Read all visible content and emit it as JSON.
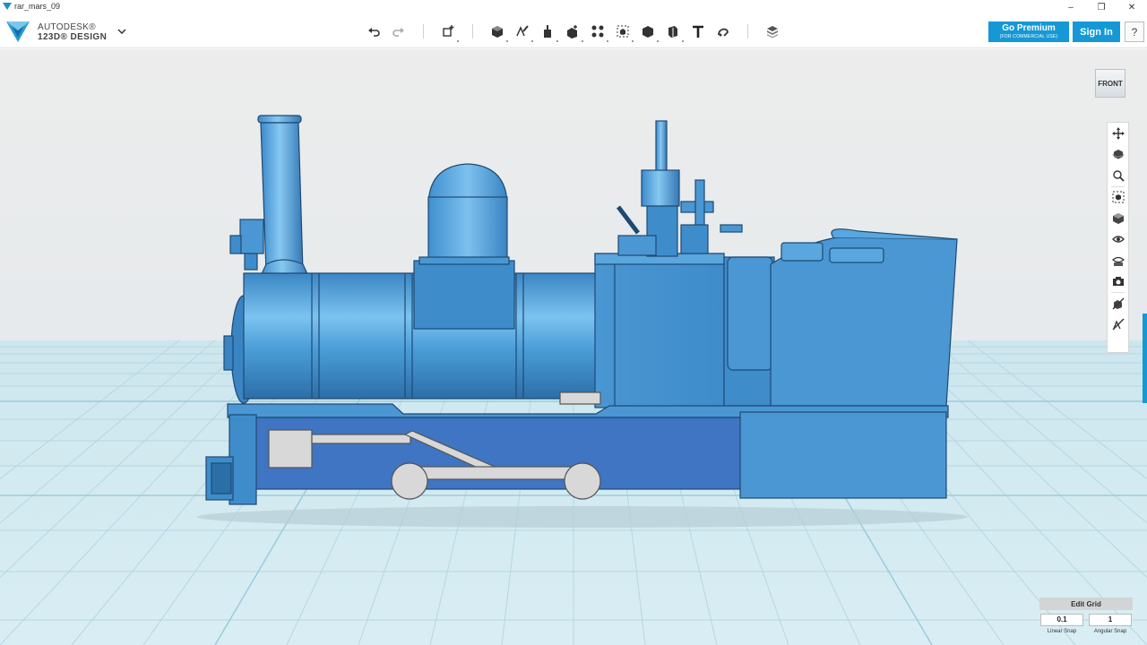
{
  "window": {
    "title": "rar_mars_09",
    "controls": {
      "minimize": "‒",
      "maximize": "❐",
      "close": "✕"
    }
  },
  "brand": {
    "line1": "AUTODESK®",
    "line2": "123D® DESIGN"
  },
  "toolbar": {
    "tools": [
      {
        "name": "undo-icon"
      },
      {
        "name": "redo-icon"
      },
      {
        "name": "transform-icon"
      },
      {
        "name": "primitives-icon"
      },
      {
        "name": "sketch-icon"
      },
      {
        "name": "construct-icon"
      },
      {
        "name": "modify-icon"
      },
      {
        "name": "pattern-icon"
      },
      {
        "name": "group-icon"
      },
      {
        "name": "combine-icon"
      },
      {
        "name": "measure-icon"
      },
      {
        "name": "text-icon"
      },
      {
        "name": "snap-icon"
      },
      {
        "name": "material-icon"
      }
    ],
    "premium": {
      "label": "Go Premium",
      "sublabel": "(FOR COMMERCIAL USE)"
    },
    "signin": "Sign In",
    "help": "?"
  },
  "viewcube": {
    "face": "FRONT"
  },
  "navbar": {
    "items": [
      "pan-icon",
      "orbit-icon",
      "zoom-icon",
      "fit-icon",
      "view-mode-icon",
      "visibility-icon",
      "materials-outlines-icon",
      "snapshot-icon",
      "hidden-objects-icon",
      "hidden-sketches-icon"
    ]
  },
  "grid": {
    "edit_label": "Edit Grid",
    "linear_snap_value": "0.1",
    "angular_snap_value": "1",
    "linear_snap_label": "Linear Snap",
    "angular_snap_label": "Angular Snap"
  },
  "colors": {
    "accent": "#1499d6",
    "model_blue": "#4a9fd6",
    "chassis_blue": "#3f75c2",
    "grid_bg": "#d6ecf2"
  }
}
